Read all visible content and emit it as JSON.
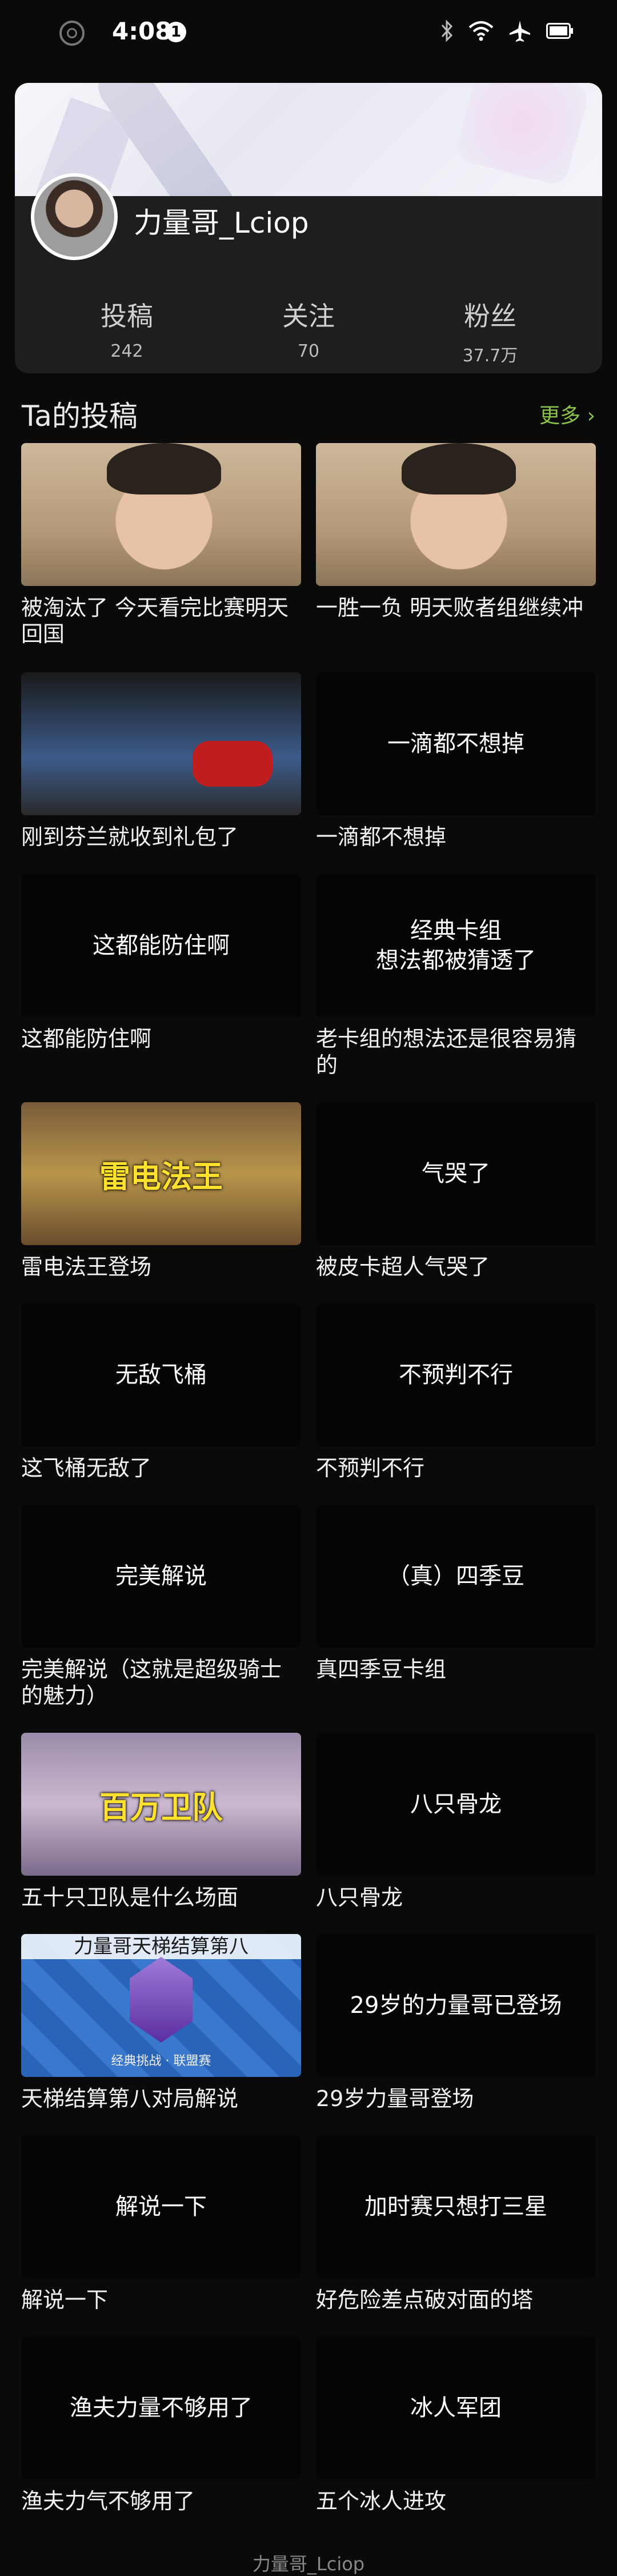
{
  "status_bar": {
    "time": "4:08",
    "badge": "1"
  },
  "profile": {
    "name": "力量哥_Lciop",
    "stats": [
      {
        "label": "投稿",
        "value": "242"
      },
      {
        "label": "关注",
        "value": "70"
      },
      {
        "label": "粉丝",
        "value": "37.7万"
      }
    ]
  },
  "section": {
    "title": "Ta的投稿",
    "more": "更多 ›"
  },
  "videos": [
    {
      "thumb": "face",
      "thumb_text": "",
      "caption": "被淘汰了 今天看完比赛明天回国"
    },
    {
      "thumb": "face",
      "thumb_text": "",
      "caption": "一胜一负 明天败者组继续冲"
    },
    {
      "thumb": "gift",
      "thumb_text": "",
      "caption": "刚到芬兰就收到礼包了"
    },
    {
      "thumb": "dark",
      "thumb_text": "一滴都不想掉",
      "caption": "一滴都不想掉"
    },
    {
      "thumb": "dark",
      "thumb_text": "这都能防住啊",
      "caption": "这都能防住啊"
    },
    {
      "thumb": "dark",
      "thumb_text": "经典卡组\n想法都被猜透了",
      "caption": "老卡组的想法还是很容易猜的"
    },
    {
      "thumb": "game",
      "thumb_text": "雷电法王",
      "caption": "雷电法王登场"
    },
    {
      "thumb": "dark",
      "thumb_text": "气哭了",
      "caption": "被皮卡超人气哭了"
    },
    {
      "thumb": "dark",
      "thumb_text": "无敌飞桶",
      "caption": "这飞桶无敌了"
    },
    {
      "thumb": "dark",
      "thumb_text": "不预判不行",
      "caption": "不预判不行"
    },
    {
      "thumb": "dark",
      "thumb_text": "完美解说",
      "caption": "完美解说（这就是超级骑士的魅力）"
    },
    {
      "thumb": "dark",
      "thumb_text": "（真）四季豆",
      "caption": "真四季豆卡组"
    },
    {
      "thumb": "game2",
      "thumb_text": "百万卫队",
      "caption": "五十只卫队是什么场面"
    },
    {
      "thumb": "dark",
      "thumb_text": "八只骨龙",
      "caption": "八只骨龙"
    },
    {
      "thumb": "crest",
      "thumb_text": "力量哥天梯结算第八",
      "thumb_sub": "经典挑战 · 联盟赛",
      "caption": "天梯结算第八对局解说"
    },
    {
      "thumb": "dark",
      "thumb_text": "29岁的力量哥已登场",
      "caption": "29岁力量哥登场"
    },
    {
      "thumb": "dark",
      "thumb_text": "解说一下",
      "caption": "解说一下"
    },
    {
      "thumb": "dark",
      "thumb_text": "加时赛只想打三星",
      "caption": "好危险差点破对面的塔"
    },
    {
      "thumb": "dark",
      "thumb_text": "渔夫力量不够用了",
      "caption": "渔夫力气不够用了"
    },
    {
      "thumb": "dark",
      "thumb_text": "冰人军团",
      "caption": "五个冰人进攻"
    }
  ],
  "footer_label": "力量哥_Lciop"
}
